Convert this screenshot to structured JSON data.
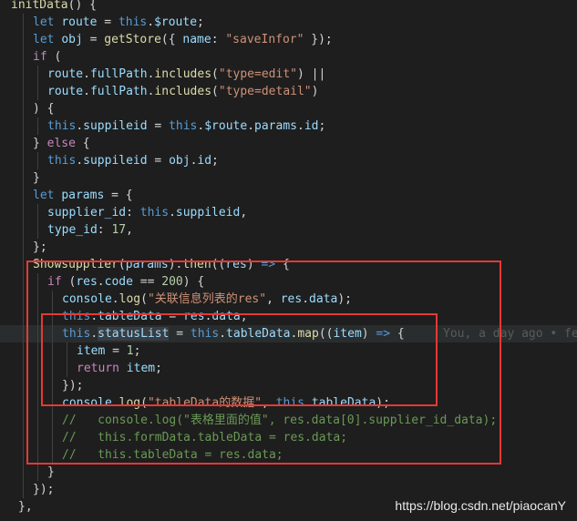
{
  "editor": {
    "lines": [
      [
        [
          "initData",
          "fn"
        ],
        [
          "() {",
          "pun"
        ]
      ],
      [
        [
          "let ",
          "kw"
        ],
        [
          "route",
          "var"
        ],
        [
          " = ",
          "pun"
        ],
        [
          "this",
          "kw"
        ],
        [
          ".",
          "pun"
        ],
        [
          "$route",
          "var"
        ],
        [
          ";",
          "pun"
        ]
      ],
      [
        [
          "let ",
          "kw"
        ],
        [
          "obj",
          "var"
        ],
        [
          " = ",
          "pun"
        ],
        [
          "getStore",
          "fn"
        ],
        [
          "({ ",
          "pun"
        ],
        [
          "name",
          "var"
        ],
        [
          ": ",
          "pun"
        ],
        [
          "\"saveInfor\"",
          "str"
        ],
        [
          " });",
          "pun"
        ]
      ],
      [
        [
          "if",
          "ctl"
        ],
        [
          " (",
          "pun"
        ]
      ],
      [
        [
          "route",
          "var"
        ],
        [
          ".",
          "pun"
        ],
        [
          "fullPath",
          "var"
        ],
        [
          ".",
          "pun"
        ],
        [
          "includes",
          "fn"
        ],
        [
          "(",
          "pun"
        ],
        [
          "\"type=edit\"",
          "str"
        ],
        [
          ") ||",
          "pun"
        ]
      ],
      [
        [
          "route",
          "var"
        ],
        [
          ".",
          "pun"
        ],
        [
          "fullPath",
          "var"
        ],
        [
          ".",
          "pun"
        ],
        [
          "includes",
          "fn"
        ],
        [
          "(",
          "pun"
        ],
        [
          "\"type=detail\"",
          "str"
        ],
        [
          ")",
          "pun"
        ]
      ],
      [
        [
          ") {",
          "pun"
        ]
      ],
      [
        [
          "this",
          "kw"
        ],
        [
          ".",
          "pun"
        ],
        [
          "suppileid",
          "var"
        ],
        [
          " = ",
          "pun"
        ],
        [
          "this",
          "kw"
        ],
        [
          ".",
          "pun"
        ],
        [
          "$route",
          "var"
        ],
        [
          ".",
          "pun"
        ],
        [
          "params",
          "var"
        ],
        [
          ".",
          "pun"
        ],
        [
          "id",
          "var"
        ],
        [
          ";",
          "pun"
        ]
      ],
      [
        [
          "} ",
          "pun"
        ],
        [
          "else",
          "ctl"
        ],
        [
          " {",
          "pun"
        ]
      ],
      [
        [
          "this",
          "kw"
        ],
        [
          ".",
          "pun"
        ],
        [
          "suppileid",
          "var"
        ],
        [
          " = ",
          "pun"
        ],
        [
          "obj",
          "var"
        ],
        [
          ".",
          "pun"
        ],
        [
          "id",
          "var"
        ],
        [
          ";",
          "pun"
        ]
      ],
      [
        [
          "}",
          "pun"
        ]
      ],
      [
        [
          "let ",
          "kw"
        ],
        [
          "params",
          "var"
        ],
        [
          " = {",
          "pun"
        ]
      ],
      [
        [
          "supplier_id",
          "var"
        ],
        [
          ": ",
          "pun"
        ],
        [
          "this",
          "kw"
        ],
        [
          ".",
          "pun"
        ],
        [
          "suppileid",
          "var"
        ],
        [
          ",",
          "pun"
        ]
      ],
      [
        [
          "type_id",
          "var"
        ],
        [
          ": ",
          "pun"
        ],
        [
          "17",
          "num"
        ],
        [
          ",",
          "pun"
        ]
      ],
      [
        [
          "};",
          "pun"
        ]
      ],
      [
        [
          "Showsupplier",
          "fn"
        ],
        [
          "(",
          "pun"
        ],
        [
          "params",
          "var"
        ],
        [
          ").",
          "pun"
        ],
        [
          "then",
          "fn"
        ],
        [
          "((",
          "pun"
        ],
        [
          "res",
          "var"
        ],
        [
          ") ",
          "pun"
        ],
        [
          "=>",
          "kw"
        ],
        [
          " {",
          "pun"
        ]
      ],
      [
        [
          "if",
          "ctl"
        ],
        [
          " (",
          "pun"
        ],
        [
          "res",
          "var"
        ],
        [
          ".",
          "pun"
        ],
        [
          "code",
          "var"
        ],
        [
          " == ",
          "pun"
        ],
        [
          "200",
          "num"
        ],
        [
          ") {",
          "pun"
        ]
      ],
      [
        [
          "console",
          "var"
        ],
        [
          ".",
          "pun"
        ],
        [
          "log",
          "fn"
        ],
        [
          "(",
          "pun"
        ],
        [
          "\"关联信息列表的res\"",
          "str"
        ],
        [
          ", ",
          "pun"
        ],
        [
          "res",
          "var"
        ],
        [
          ".",
          "pun"
        ],
        [
          "data",
          "var"
        ],
        [
          ");",
          "pun"
        ]
      ],
      [
        [
          "this",
          "kw"
        ],
        [
          ".",
          "pun"
        ],
        [
          "tableData",
          "var"
        ],
        [
          " = ",
          "pun"
        ],
        [
          "res",
          "var"
        ],
        [
          ".",
          "pun"
        ],
        [
          "data",
          "var"
        ],
        [
          ";",
          "pun"
        ]
      ],
      [
        [
          "this",
          "kw"
        ],
        [
          ".",
          "pun"
        ],
        [
          "statusList",
          "var",
          "sel"
        ],
        [
          " = ",
          "pun"
        ],
        [
          "this",
          "kw"
        ],
        [
          ".",
          "pun"
        ],
        [
          "tableData",
          "var"
        ],
        [
          ".",
          "pun"
        ],
        [
          "map",
          "fn"
        ],
        [
          "((",
          "pun"
        ],
        [
          "item",
          "var"
        ],
        [
          ") ",
          "pun"
        ],
        [
          "=>",
          "kw"
        ],
        [
          " {",
          "pun"
        ]
      ],
      [
        [
          "item",
          "var"
        ],
        [
          " = ",
          "pun"
        ],
        [
          "1",
          "num"
        ],
        [
          ";",
          "pun"
        ]
      ],
      [
        [
          "return",
          "ctl"
        ],
        [
          " ",
          "pun"
        ],
        [
          "item",
          "var"
        ],
        [
          ";",
          "pun"
        ]
      ],
      [
        [
          "});",
          "pun"
        ]
      ],
      [
        [
          "console",
          "var"
        ],
        [
          ".",
          "pun"
        ],
        [
          "log",
          "fn"
        ],
        [
          "(",
          "pun"
        ],
        [
          "\"tableData的数据\"",
          "str"
        ],
        [
          ", ",
          "pun"
        ],
        [
          "this",
          "kw"
        ],
        [
          ".",
          "pun"
        ],
        [
          "tableData",
          "var"
        ],
        [
          ");",
          "pun"
        ]
      ],
      [
        [
          "//   console.log(\"表格里面的值\", res.data[0].supplier_id_data);",
          "cmt"
        ]
      ],
      [
        [
          "//   this.formData.tableData = res.data;",
          "cmt"
        ]
      ],
      [
        [
          "//   this.tableData = res.data;",
          "cmt"
        ]
      ],
      [
        [
          "}",
          "pun"
        ]
      ],
      [
        [
          "});",
          "pun"
        ]
      ],
      [
        [
          "},",
          "pun"
        ]
      ]
    ],
    "blame": "You, a day ago • fe"
  },
  "watermark": "https://blog.csdn.net/piaocanY",
  "colors": {
    "annotation_box": "#e53935",
    "background": "#1e1e1e"
  }
}
